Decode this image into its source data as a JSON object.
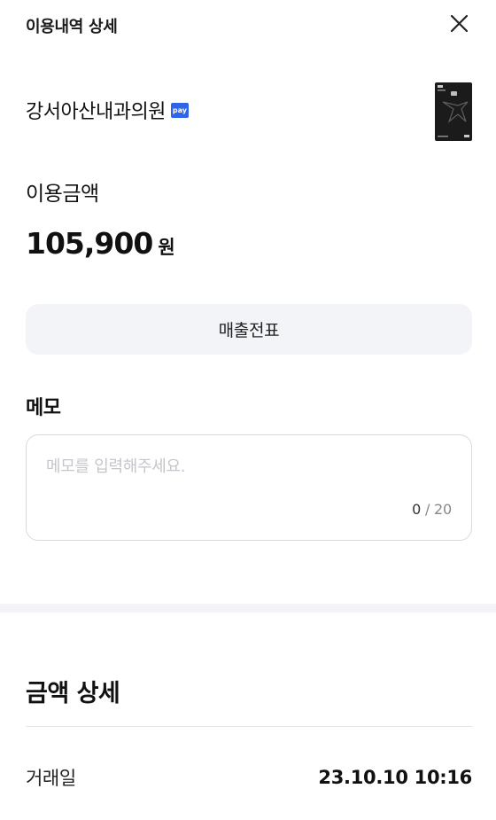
{
  "header": {
    "title": "이용내역 상세",
    "close_icon": "close-icon"
  },
  "merchant": {
    "name": "강서아산내과의원",
    "badge_label": "pay",
    "badge_color": "#2f63ea",
    "card_icon": "card-thumbnail-icon"
  },
  "amount": {
    "label": "이용금액",
    "value": "105,900",
    "unit": "원"
  },
  "sales_slip": {
    "label": "매출전표"
  },
  "memo": {
    "title": "메모",
    "placeholder": "메모를 입력해주세요.",
    "current_count": "0",
    "separator": " / ",
    "max_count": "20"
  },
  "amount_detail": {
    "title": "금액 상세",
    "rows": [
      {
        "key": "거래일",
        "value": "23.10.10 10:16"
      }
    ]
  },
  "colors": {
    "accent_button_bg": "#f3f4f8",
    "divider_bg": "#f3f4f8",
    "border": "#d7d9de"
  }
}
